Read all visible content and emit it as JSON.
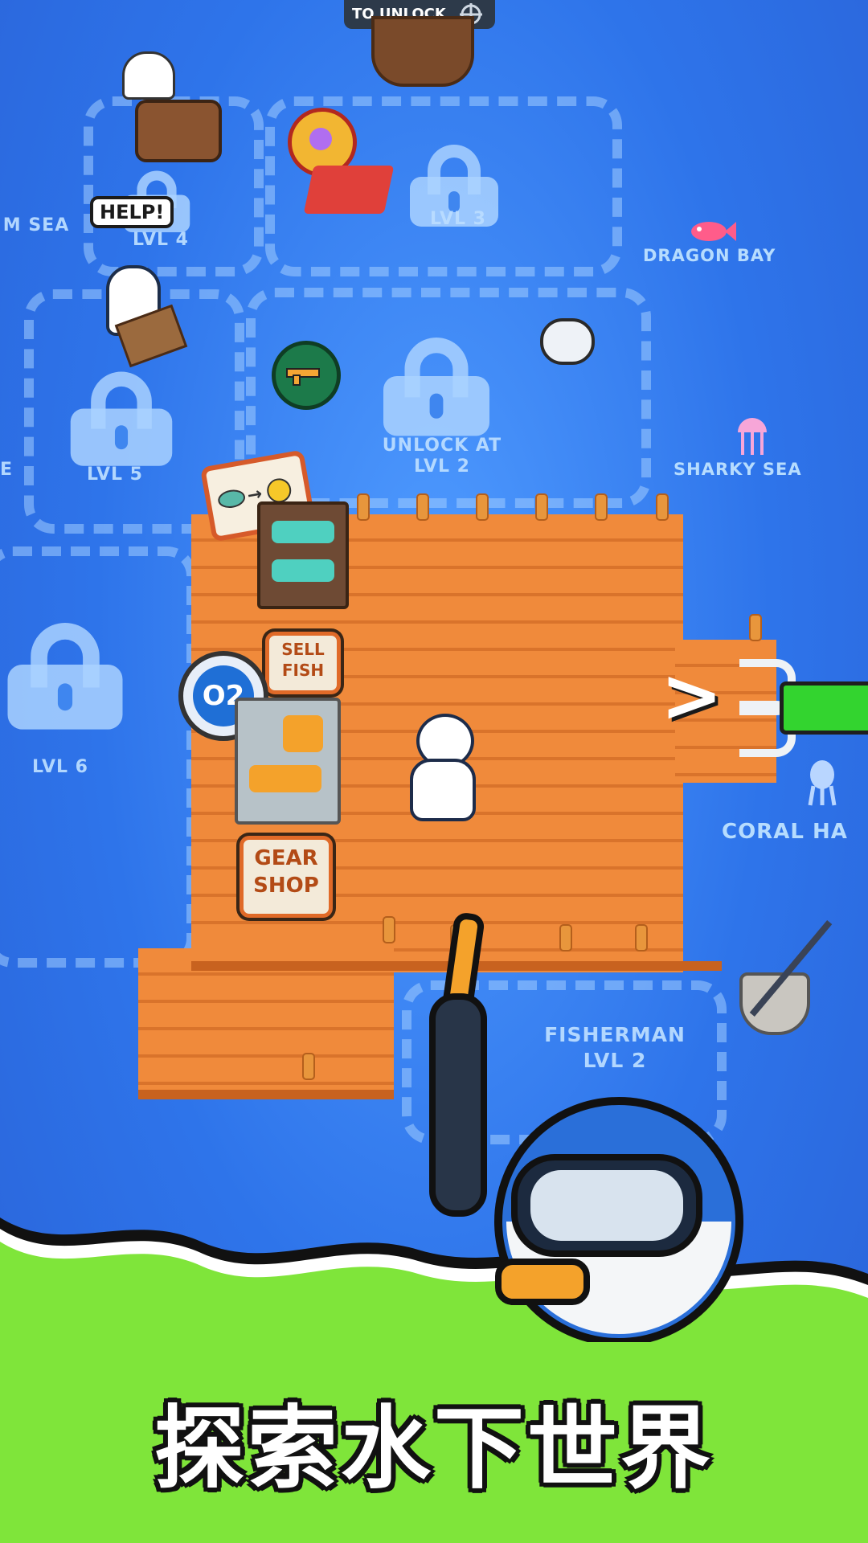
{
  "top_banner": {
    "text": "TO UNLOCK"
  },
  "help_bubble": {
    "text": "HELP!"
  },
  "zones": {
    "m_sea": "M SEA",
    "lvl4": "LVL 4",
    "lvl3": "LVL 3",
    "lvl5": "LVL 5",
    "unlock_lvl2_line1": "UNLOCK AT",
    "unlock_lvl2_line2": "LVL 2",
    "lvl6": "LVL 6",
    "fisherman_line1": "FISHERMAN",
    "fisherman_line2": "LVL 2",
    "left_edge_e": "E"
  },
  "regions": {
    "dragon_bay": "DRAGON BAY",
    "sharky_sea": "SHARKY SEA",
    "coral_ha": "CORAL HA"
  },
  "signs": {
    "sell_fish_line1": "SELL",
    "sell_fish_line2": "FISH",
    "gear_shop_line1": "GEAR",
    "gear_shop_line2": "SHOP",
    "oxygen": "O2"
  },
  "direction_arrow": ">",
  "headline": "探索水下世界",
  "colors": {
    "water": "#2e74ea",
    "dock": "#f08a3b",
    "band_green": "#7fe53a",
    "progress_green": "#33d42f"
  },
  "icons": [
    "lock-icon",
    "fish-to-coin-icon",
    "gun-icon",
    "jellyfish-icon",
    "squid-icon",
    "fish-icon",
    "diving-helmet-icon"
  ]
}
